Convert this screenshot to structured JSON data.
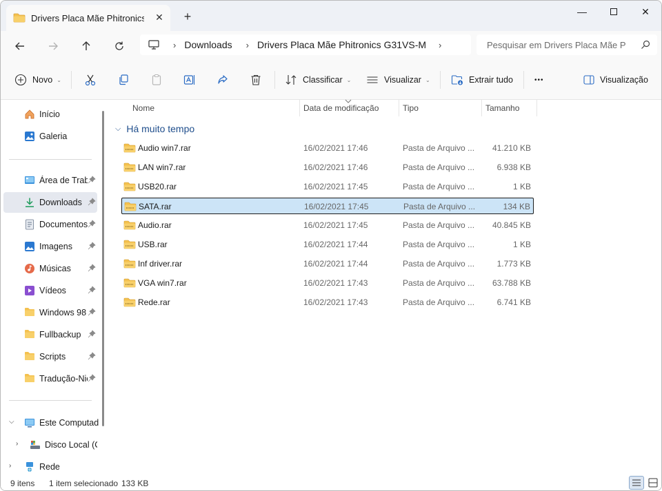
{
  "window": {
    "tab_title": "Drivers Placa Mãe Phitronics G",
    "controls": {
      "minimize": "—",
      "maximize": "☐",
      "close": "✕"
    }
  },
  "address": {
    "crumbs": [
      "Downloads",
      "Drivers Placa Mãe Phitronics G31VS-M"
    ],
    "search_placeholder": "Pesquisar em Drivers Placa Mãe P"
  },
  "toolbar": {
    "new_label": "Novo",
    "sort_label": "Classificar",
    "view_label": "Visualizar",
    "extract_label": "Extrair tudo",
    "more_label": "•••",
    "preview_label": "Visualização"
  },
  "sidebar": {
    "items": [
      {
        "label": "Início",
        "icon": "home-icon",
        "pinned": false
      },
      {
        "label": "Galeria",
        "icon": "gallery-icon",
        "pinned": false
      },
      {
        "label": "Área de Trabalho",
        "icon": "desktop-icon",
        "pinned": true
      },
      {
        "label": "Downloads",
        "icon": "download-icon",
        "pinned": true,
        "selected": true
      },
      {
        "label": "Documentos",
        "icon": "documents-icon",
        "pinned": true
      },
      {
        "label": "Imagens",
        "icon": "pictures-icon",
        "pinned": true
      },
      {
        "label": "Músicas",
        "icon": "music-icon",
        "pinned": true
      },
      {
        "label": "Vídeos",
        "icon": "videos-icon",
        "pinned": true
      },
      {
        "label": "Windows 98",
        "icon": "folder-icon",
        "pinned": true
      },
      {
        "label": "Fullbackup",
        "icon": "folder-icon",
        "pinned": true
      },
      {
        "label": "Scripts",
        "icon": "folder-icon",
        "pinned": true
      },
      {
        "label": "Tradução-Nier",
        "icon": "folder-icon",
        "pinned": true
      }
    ],
    "tree": [
      {
        "label": "Este Computador",
        "icon": "computer-icon"
      },
      {
        "label": "Disco Local (C:)",
        "icon": "drive-icon"
      },
      {
        "label": "Rede",
        "icon": "network-icon"
      }
    ]
  },
  "columns": [
    "Nome",
    "Data de modificação",
    "Tipo",
    "Tamanho"
  ],
  "group": {
    "label": "Há muito tempo"
  },
  "files": [
    {
      "name": "Audio win7.rar",
      "date": "16/02/2021 17:46",
      "type": "Pasta de Arquivo ...",
      "size": "41.210 KB"
    },
    {
      "name": "LAN win7.rar",
      "date": "16/02/2021 17:46",
      "type": "Pasta de Arquivo ...",
      "size": "6.938 KB"
    },
    {
      "name": "USB20.rar",
      "date": "16/02/2021 17:45",
      "type": "Pasta de Arquivo ...",
      "size": "1 KB"
    },
    {
      "name": "SATA.rar",
      "date": "16/02/2021 17:45",
      "type": "Pasta de Arquivo ...",
      "size": "134 KB",
      "selected": true
    },
    {
      "name": "Audio.rar",
      "date": "16/02/2021 17:45",
      "type": "Pasta de Arquivo ...",
      "size": "40.845 KB"
    },
    {
      "name": "USB.rar",
      "date": "16/02/2021 17:44",
      "type": "Pasta de Arquivo ...",
      "size": "1 KB"
    },
    {
      "name": "Inf driver.rar",
      "date": "16/02/2021 17:44",
      "type": "Pasta de Arquivo ...",
      "size": "1.773 KB"
    },
    {
      "name": "VGA win7.rar",
      "date": "16/02/2021 17:43",
      "type": "Pasta de Arquivo ...",
      "size": "63.788 KB"
    },
    {
      "name": "Rede.rar",
      "date": "16/02/2021 17:43",
      "type": "Pasta de Arquivo ...",
      "size": "6.741 KB"
    }
  ],
  "status": {
    "count": "9 itens",
    "selection": "1 item selecionado",
    "size": "133 KB"
  },
  "colors": {
    "accent": "#0067c0",
    "selected_row": "#cce4f7",
    "group_header": "#1f4e8c",
    "folder": "#f4c14f"
  }
}
